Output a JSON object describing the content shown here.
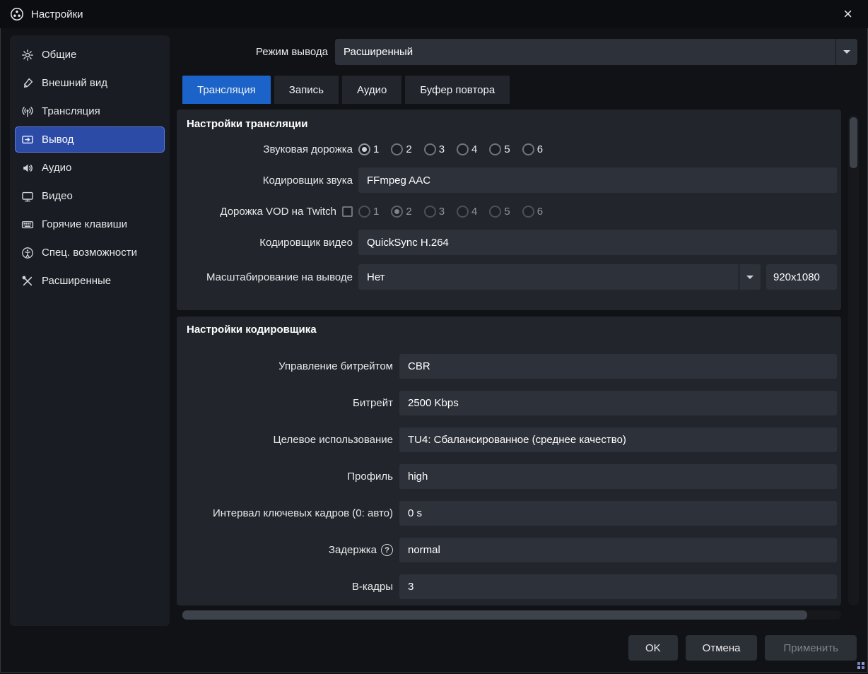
{
  "window": {
    "title": "Настройки"
  },
  "titlebar": {
    "close_label": "×"
  },
  "colors": {
    "tab_active": "#1b63c8",
    "sidebar_selected": "#2c4ba6",
    "field_bg": "#2d313a",
    "panel_bg": "#22252b"
  },
  "sidebar": {
    "items": [
      {
        "label": "Общие",
        "icon": "gear-icon"
      },
      {
        "label": "Внешний вид",
        "icon": "paintbrush-icon"
      },
      {
        "label": "Трансляция",
        "icon": "broadcast-icon"
      },
      {
        "label": "Вывод",
        "icon": "output-icon",
        "selected": true
      },
      {
        "label": "Аудио",
        "icon": "speaker-icon"
      },
      {
        "label": "Видео",
        "icon": "monitor-icon"
      },
      {
        "label": "Горячие клавиши",
        "icon": "keyboard-icon"
      },
      {
        "label": "Спец. возможности",
        "icon": "accessibility-icon"
      },
      {
        "label": "Расширенные",
        "icon": "tools-icon"
      }
    ]
  },
  "output_mode": {
    "label": "Режим вывода",
    "value": "Расширенный"
  },
  "tabs": [
    {
      "label": "Трансляция",
      "active": true
    },
    {
      "label": "Запись",
      "active": false
    },
    {
      "label": "Аудио",
      "active": false
    },
    {
      "label": "Буфер повтора",
      "active": false
    }
  ],
  "stream_section": {
    "title": "Настройки трансляции",
    "audio_track": {
      "label": "Звуковая дорожка",
      "options": [
        "1",
        "2",
        "3",
        "4",
        "5",
        "6"
      ],
      "selected": "1"
    },
    "audio_encoder": {
      "label": "Кодировщик звука",
      "value": "FFmpeg AAC"
    },
    "twitch_vod": {
      "label": "Дорожка VOD на Twitch",
      "checked": false,
      "options": [
        "1",
        "2",
        "3",
        "4",
        "5",
        "6"
      ],
      "selected": "2"
    },
    "video_encoder": {
      "label": "Кодировщик видео",
      "value": "QuickSync H.264"
    },
    "rescale": {
      "label": "Масштабирование на выводе",
      "value": "Нет",
      "resolution": "920x1080"
    }
  },
  "encoder_section": {
    "title": "Настройки кодировщика",
    "rows": [
      {
        "label": "Управление битрейтом",
        "value": "CBR"
      },
      {
        "label": "Битрейт",
        "value": "2500 Kbps"
      },
      {
        "label": "Целевое использование",
        "value": "TU4: Сбалансированное (среднее качество)"
      },
      {
        "label": "Профиль",
        "value": "high"
      },
      {
        "label": "Интервал ключевых кадров (0: авто)",
        "value": "0 s"
      },
      {
        "label": "Задержка",
        "value": "normal",
        "help": "?"
      },
      {
        "label": "В-кадры",
        "value": "3"
      }
    ]
  },
  "footer": {
    "ok": "OK",
    "cancel": "Отмена",
    "apply": "Применить"
  }
}
